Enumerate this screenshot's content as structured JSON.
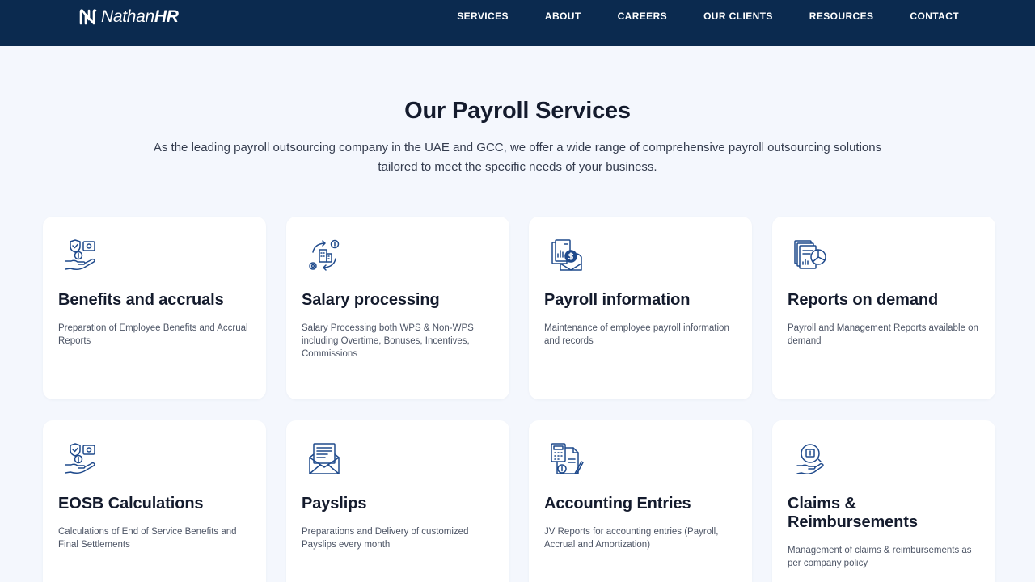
{
  "brand": {
    "name_regular": "Nathan",
    "name_bold": "HR",
    "colors": {
      "navbar": "#0b2a4f",
      "icon_primary": "#1f4a8c",
      "page_bg": "#f4f7fd"
    }
  },
  "nav": {
    "items": [
      {
        "label": "SERVICES"
      },
      {
        "label": "ABOUT"
      },
      {
        "label": "CAREERS"
      },
      {
        "label": "OUR CLIENTS"
      },
      {
        "label": "RESOURCES"
      },
      {
        "label": "CONTACT"
      }
    ]
  },
  "section": {
    "title": "Our Payroll Services",
    "subtitle": "As the leading payroll outsourcing company in the UAE and GCC, we offer a wide range of comprehensive payroll outsourcing solutions tailored to meet the specific needs of your business."
  },
  "cards": [
    {
      "title": "Benefits and accruals",
      "desc": "Preparation of Employee Benefits and Accrual Reports",
      "icon": "hand-money-icon"
    },
    {
      "title": "Salary processing",
      "desc": "Salary Processing both WPS & Non-WPS including Overtime, Bonuses, Incentives, Commissions",
      "icon": "salary-cycle-icon"
    },
    {
      "title": "Payroll information",
      "desc": "Maintenance of employee payroll information and records",
      "icon": "payroll-docs-icon"
    },
    {
      "title": "Reports on demand",
      "desc": "Payroll and Management Reports available on demand",
      "icon": "report-chart-icon"
    },
    {
      "title": "EOSB Calculations",
      "desc": "Calculations of End of Service Benefits and Final Settlements",
      "icon": "hand-money-icon"
    },
    {
      "title": "Payslips",
      "desc": "Preparations and Delivery of customized Payslips every month",
      "icon": "payslip-envelope-icon"
    },
    {
      "title": "Accounting Entries",
      "desc": "JV Reports for accounting entries (Payroll, Accrual and Amortization)",
      "icon": "calculator-doc-icon"
    },
    {
      "title": "Claims & Reimbursements",
      "desc": "Management of claims & reimbursements as per company policy",
      "icon": "claims-hand-icon"
    }
  ]
}
